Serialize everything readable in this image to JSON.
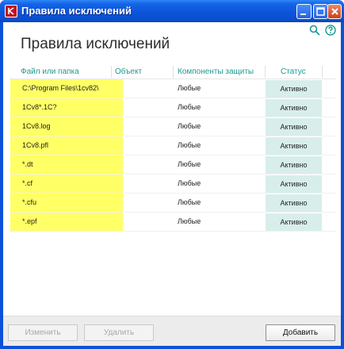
{
  "window": {
    "title": "Правила исключений"
  },
  "page": {
    "heading": "Правила исключений"
  },
  "table": {
    "columns": {
      "path": "Файл или папка",
      "object": "Объект",
      "components": "Компоненты защиты",
      "status": "Статус"
    },
    "rows": [
      {
        "path": "C:\\Program Files\\1cv82\\",
        "object": "",
        "components": "Любые",
        "status": "Активно"
      },
      {
        "path": "1Cv8*.1C?",
        "object": "",
        "components": "Любые",
        "status": "Активно"
      },
      {
        "path": "1Cv8.log",
        "object": "",
        "components": "Любые",
        "status": "Активно"
      },
      {
        "path": "1Cv8.pfl",
        "object": "",
        "components": "Любые",
        "status": "Активно"
      },
      {
        "path": "*.dt",
        "object": "",
        "components": "Любые",
        "status": "Активно"
      },
      {
        "path": "*.cf",
        "object": "",
        "components": "Любые",
        "status": "Активно"
      },
      {
        "path": "*.cfu",
        "object": "",
        "components": "Любые",
        "status": "Активно"
      },
      {
        "path": "*.epf",
        "object": "",
        "components": "Любые",
        "status": "Активно"
      }
    ]
  },
  "footer": {
    "edit_label": "Изменить",
    "delete_label": "Удалить",
    "add_label": "Добавить"
  },
  "icons": {
    "search": "search-icon",
    "help": "help-icon"
  },
  "colors": {
    "accent": "#1b9a8f",
    "highlight": "#ffff66",
    "status_bg": "#d8eeeb",
    "titlebar": "#0a52d8"
  }
}
